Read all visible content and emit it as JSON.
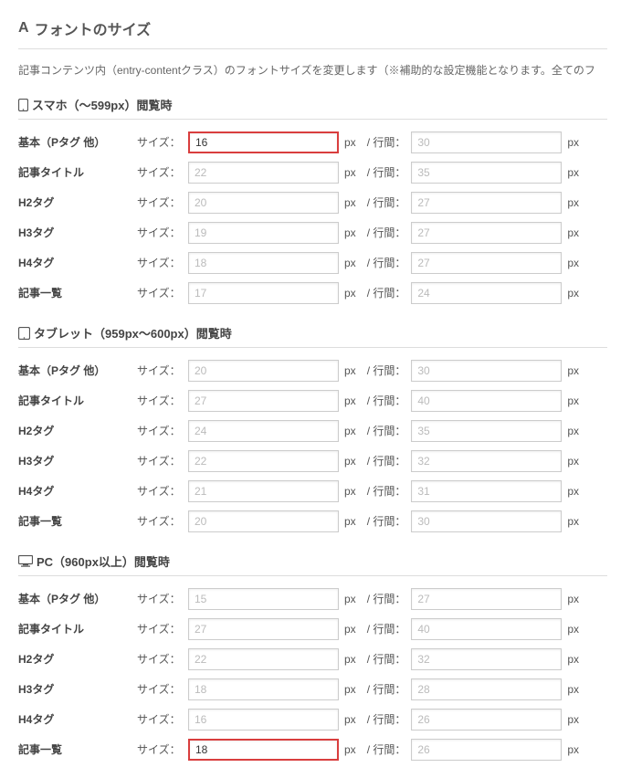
{
  "header": {
    "icon": "A",
    "title": "フォントのサイズ"
  },
  "description": "記事コンテンツ内（entry-contentクラス）のフォントサイズを変更します（※補助的な設定機能となります。全てのフ",
  "labels": {
    "size": "サイズ：",
    "px": "px",
    "sep": "/ 行間：",
    "px2": "px"
  },
  "groups": [
    {
      "iconType": "mobile",
      "title": "スマホ（～599px）閲覧時",
      "rows": [
        {
          "label": "基本（Pタグ 他）",
          "size_val": "16",
          "size_ph": "",
          "hl": true,
          "lh_val": "",
          "lh_ph": "30"
        },
        {
          "label": "記事タイトル",
          "size_val": "",
          "size_ph": "22",
          "hl": false,
          "lh_val": "",
          "lh_ph": "35"
        },
        {
          "label": "H2タグ",
          "size_val": "",
          "size_ph": "20",
          "hl": false,
          "lh_val": "",
          "lh_ph": "27"
        },
        {
          "label": "H3タグ",
          "size_val": "",
          "size_ph": "19",
          "hl": false,
          "lh_val": "",
          "lh_ph": "27"
        },
        {
          "label": "H4タグ",
          "size_val": "",
          "size_ph": "18",
          "hl": false,
          "lh_val": "",
          "lh_ph": "27"
        },
        {
          "label": "記事一覧",
          "size_val": "",
          "size_ph": "17",
          "hl": false,
          "lh_val": "",
          "lh_ph": "24"
        }
      ]
    },
    {
      "iconType": "tablet",
      "title": "タブレット（959px～600px）閲覧時",
      "rows": [
        {
          "label": "基本（Pタグ 他）",
          "size_val": "",
          "size_ph": "20",
          "hl": false,
          "lh_val": "",
          "lh_ph": "30"
        },
        {
          "label": "記事タイトル",
          "size_val": "",
          "size_ph": "27",
          "hl": false,
          "lh_val": "",
          "lh_ph": "40"
        },
        {
          "label": "H2タグ",
          "size_val": "",
          "size_ph": "24",
          "hl": false,
          "lh_val": "",
          "lh_ph": "35"
        },
        {
          "label": "H3タグ",
          "size_val": "",
          "size_ph": "22",
          "hl": false,
          "lh_val": "",
          "lh_ph": "32"
        },
        {
          "label": "H4タグ",
          "size_val": "",
          "size_ph": "21",
          "hl": false,
          "lh_val": "",
          "lh_ph": "31"
        },
        {
          "label": "記事一覧",
          "size_val": "",
          "size_ph": "20",
          "hl": false,
          "lh_val": "",
          "lh_ph": "30"
        }
      ]
    },
    {
      "iconType": "pc",
      "title": "PC（960px以上）閲覧時",
      "rows": [
        {
          "label": "基本（Pタグ 他）",
          "size_val": "",
          "size_ph": "15",
          "hl": false,
          "lh_val": "",
          "lh_ph": "27"
        },
        {
          "label": "記事タイトル",
          "size_val": "",
          "size_ph": "27",
          "hl": false,
          "lh_val": "",
          "lh_ph": "40"
        },
        {
          "label": "H2タグ",
          "size_val": "",
          "size_ph": "22",
          "hl": false,
          "lh_val": "",
          "lh_ph": "32"
        },
        {
          "label": "H3タグ",
          "size_val": "",
          "size_ph": "18",
          "hl": false,
          "lh_val": "",
          "lh_ph": "28"
        },
        {
          "label": "H4タグ",
          "size_val": "",
          "size_ph": "16",
          "hl": false,
          "lh_val": "",
          "lh_ph": "26"
        },
        {
          "label": "記事一覧",
          "size_val": "18",
          "size_ph": "",
          "hl": true,
          "lh_val": "",
          "lh_ph": "26"
        }
      ]
    }
  ]
}
